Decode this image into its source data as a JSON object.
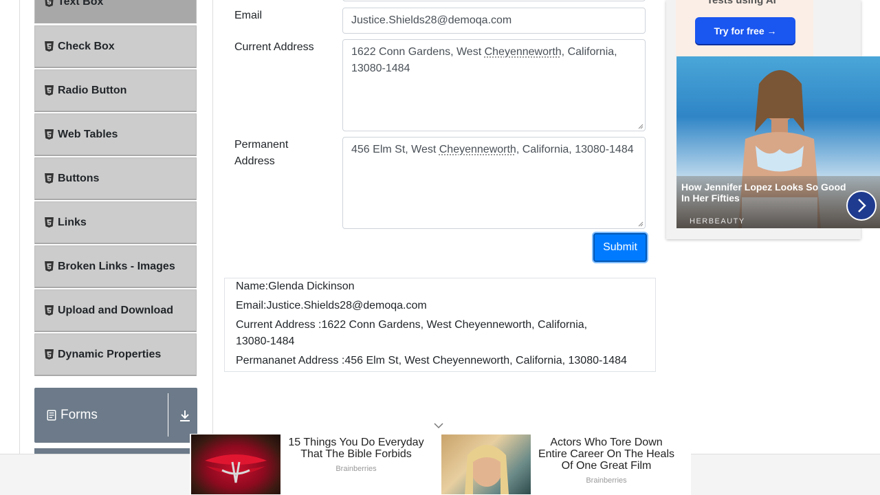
{
  "sidebar": {
    "items": [
      {
        "label": "Text Box",
        "icon": "html5-icon"
      },
      {
        "label": "Check Box",
        "icon": "html5-icon"
      },
      {
        "label": "Radio Button",
        "icon": "html5-icon"
      },
      {
        "label": "Web Tables",
        "icon": "html5-icon"
      },
      {
        "label": "Buttons",
        "icon": "html5-icon"
      },
      {
        "label": "Links",
        "icon": "html5-icon"
      },
      {
        "label": "Broken Links - Images",
        "icon": "html5-icon"
      },
      {
        "label": "Upload and Download",
        "icon": "html5-icon"
      },
      {
        "label": "Dynamic Properties",
        "icon": "html5-icon"
      }
    ],
    "group": {
      "label": "Forms",
      "icon": "document-icon",
      "toggle_icon": "download-arrow-icon"
    }
  },
  "form": {
    "email": {
      "label": "Email",
      "value": "Justice.Shields28@demoqa.com"
    },
    "current_address": {
      "label": "Current Address",
      "value_pre": "1622 Conn Gardens, West ",
      "value_squiggle": "Cheyenneworth",
      "value_post": ", California,",
      "value_line2": "13080-1484"
    },
    "permanent_address": {
      "label_line1": "Permanent",
      "label_line2": "Address",
      "value_pre": "456 Elm St, West ",
      "value_squiggle": "Cheyenneworth",
      "value_post": ", California, 13080-1484"
    },
    "submit_label": "Submit"
  },
  "output": {
    "name": "Name:Glenda Dickinson",
    "email": "Email:Justice.Shields28@demoqa.com",
    "current_address_line1": "Current Address :1622 Conn Gardens, West Cheyenneworth, California,",
    "current_address_line2": "13080-1484",
    "permanent_address": "Permananet Address :456 Elm St, West Cheyenneworth, California, 13080-1484"
  },
  "ad_right": {
    "headline_partial": "Tests using AI",
    "button_label": "Try for free →",
    "caption": "How Jennifer Lopez Looks So Good In Her Fifties",
    "brand": "HERBEAUTY"
  },
  "ad_bottom": {
    "items": [
      {
        "title_line1": "15 Things You Do Everyday",
        "title_line2": "That The Bible Forbids",
        "brand": "Brainberries"
      },
      {
        "title_line1": "Actors Who Tore Down",
        "title_line2": "Entire Career On The Heals",
        "title_line3": "Of One Great Film",
        "brand": "Brainberries"
      }
    ]
  },
  "colors": {
    "accent": "#007bff",
    "sidebar_item": "#cccccc",
    "group_header": "#6c7a89"
  }
}
